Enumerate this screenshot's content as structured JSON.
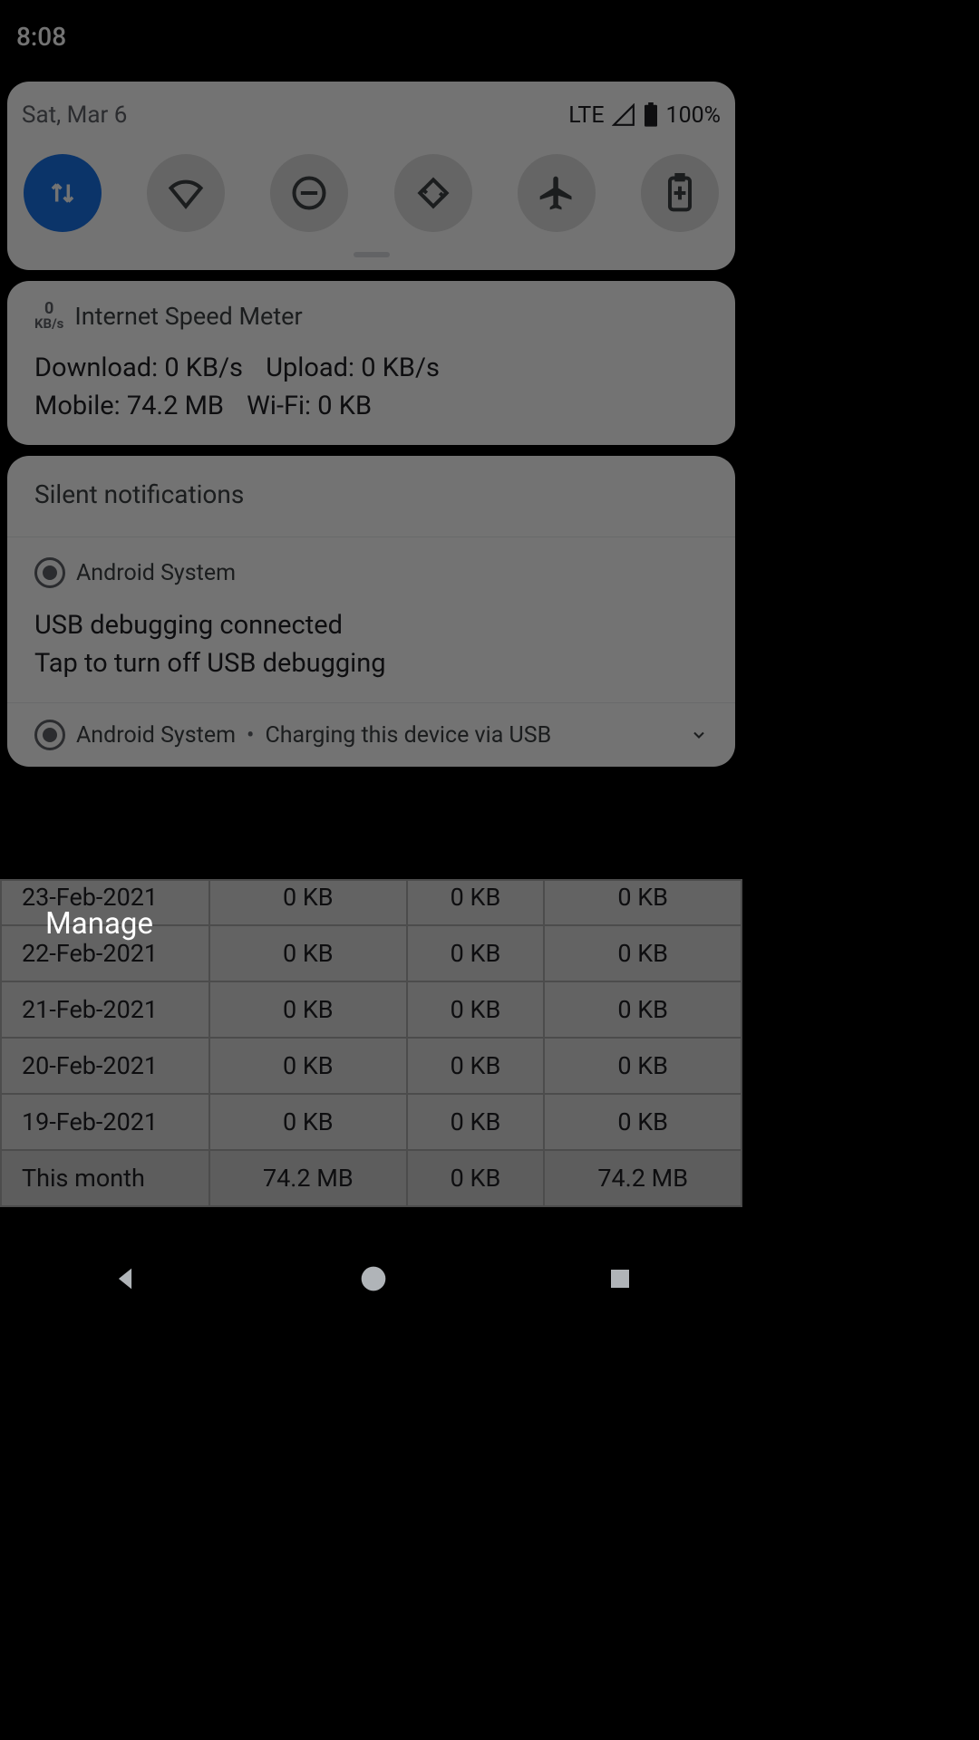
{
  "statusbar": {
    "time": "8:08"
  },
  "qs": {
    "date": "Sat, Mar 6",
    "network_label": "LTE",
    "battery_pct": "100%",
    "tiles": [
      "mobile-data",
      "wifi",
      "dnd",
      "auto-rotate",
      "airplane",
      "battery-saver"
    ]
  },
  "notifications": {
    "speed_meter": {
      "app": "Internet Speed Meter",
      "icon_value": "0",
      "icon_unit": "KB/s",
      "lines": {
        "download": "Download: 0 KB/s",
        "upload": "Upload: 0 KB/s",
        "mobile": "Mobile: 74.2 MB",
        "wifi": "Wi-Fi: 0 KB"
      }
    },
    "silent_header": "Silent notifications",
    "usb_debug": {
      "app": "Android System",
      "title": "USB debugging connected",
      "subtitle": "Tap to turn off USB debugging"
    },
    "charging": {
      "app": "Android System",
      "dot": "•",
      "title": "Charging this device via USB"
    }
  },
  "manage_label": "Manage",
  "table": {
    "rows": [
      {
        "date": "23-Feb-2021",
        "c1": "0 KB",
        "c2": "0 KB",
        "c3": "0 KB"
      },
      {
        "date": "22-Feb-2021",
        "c1": "0 KB",
        "c2": "0 KB",
        "c3": "0 KB"
      },
      {
        "date": "21-Feb-2021",
        "c1": "0 KB",
        "c2": "0 KB",
        "c3": "0 KB"
      },
      {
        "date": "20-Feb-2021",
        "c1": "0 KB",
        "c2": "0 KB",
        "c3": "0 KB"
      },
      {
        "date": "19-Feb-2021",
        "c1": "0 KB",
        "c2": "0 KB",
        "c3": "0 KB"
      }
    ],
    "total": {
      "label": "This month",
      "c1": "74.2 MB",
      "c2": "0 KB",
      "c3": "74.2 MB"
    }
  }
}
